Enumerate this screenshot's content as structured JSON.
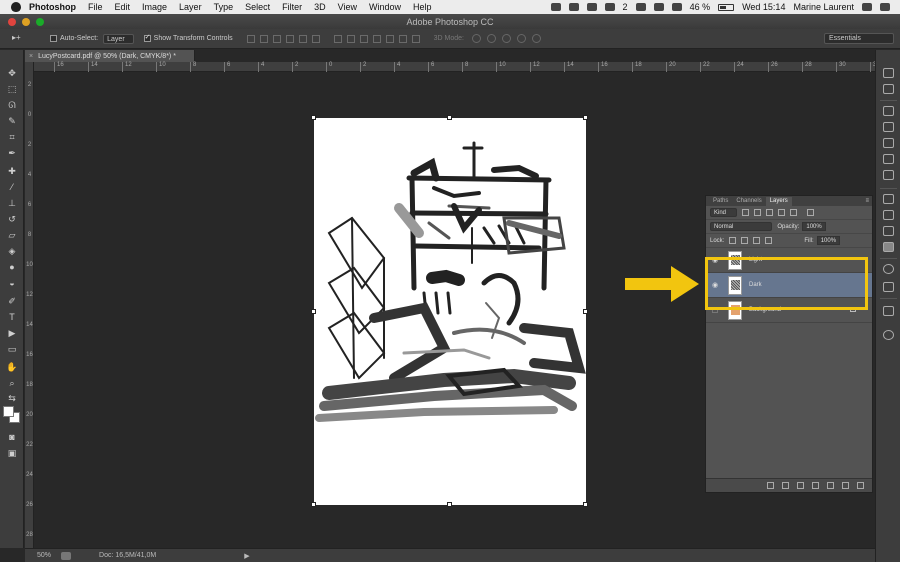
{
  "menubar": {
    "app_name": "Photoshop",
    "items": [
      "File",
      "Edit",
      "Image",
      "Layer",
      "Type",
      "Select",
      "Filter",
      "3D",
      "View",
      "Window",
      "Help"
    ],
    "status": {
      "notif_count": "2",
      "battery": "46 %",
      "datetime": "Wed 15:14",
      "user": "Marine Laurent"
    }
  },
  "window": {
    "title": "Adobe Photoshop CC"
  },
  "options_bar": {
    "auto_select_label": "Auto-Select:",
    "auto_select_value": "Layer",
    "show_transform_label": "Show Transform Controls",
    "mode_3d_label": "3D Mode:",
    "workspace": "Essentials"
  },
  "document": {
    "tab_title": "LucyPostcard.pdf @ 50% (Dark, CMYK/8*) *"
  },
  "rulers": {
    "h_ticks": [
      "16",
      "14",
      "12",
      "10",
      "8",
      "6",
      "4",
      "2",
      "0",
      "2",
      "4",
      "6",
      "8",
      "10",
      "12",
      "14",
      "16",
      "18",
      "20",
      "22",
      "24",
      "26",
      "28",
      "30",
      "32"
    ],
    "v_ticks": [
      "2",
      "0",
      "2",
      "4",
      "6",
      "8",
      "10",
      "12",
      "14",
      "16",
      "18",
      "20",
      "22",
      "24",
      "26",
      "28"
    ]
  },
  "layers_panel": {
    "tabs": [
      "Paths",
      "Channels",
      "Layers"
    ],
    "active_tab": "Layers",
    "filter_kind": "Kind",
    "blend_mode": "Normal",
    "opacity_label": "Opacity:",
    "opacity_value": "100%",
    "lock_label": "Lock:",
    "fill_label": "Fill:",
    "fill_value": "100%",
    "layers": [
      {
        "name": "Light",
        "visible": true,
        "selected": false
      },
      {
        "name": "Dark",
        "visible": true,
        "selected": true
      },
      {
        "name": "Background",
        "visible": false,
        "selected": false,
        "locked": true
      }
    ]
  },
  "annotation": {
    "highlight_color": "#f2c50f"
  },
  "statusbar": {
    "zoom": "50%",
    "doc_info": "Doc: 16,5M/41,0M"
  }
}
